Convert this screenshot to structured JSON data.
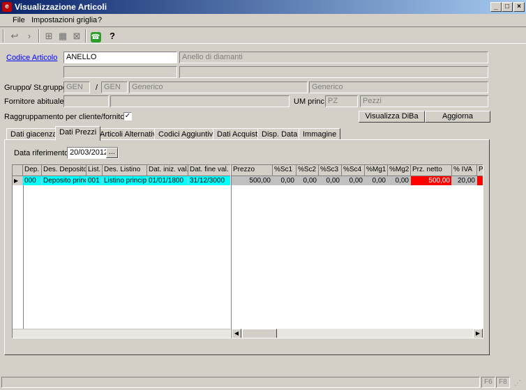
{
  "window": {
    "title": "Visualizzazione Articoli",
    "app_icon": "e"
  },
  "menu": [
    "File",
    "Impostazioni griglia",
    "?"
  ],
  "toolbar_icons": [
    "undo-icon",
    "redo-icon",
    "filter-icon",
    "grid-icon",
    "filter-clear-icon",
    "phone-icon",
    "help-icon"
  ],
  "form": {
    "codice_label": "Codice Articolo",
    "codice_value": "ANELLO",
    "descrizione": "Anello di diamanti",
    "gruppo_label": "Gruppo",
    "stgruppo_label": "/ St.gruppo",
    "gruppo_code": "GEN",
    "slash": "/",
    "stgruppo_code": "GEN",
    "gruppo_desc": "Generico",
    "stgruppo_desc": "Generico",
    "fornitore_label": "Fornitore abituale",
    "um_label": "UM princ.",
    "um_code": "PZ",
    "um_desc": "Pezzi",
    "raggruppamento_label": "Raggruppamento per cliente/fornitore",
    "raggruppamento_checked": "✓",
    "btn_diba": "Visualizza DiBa",
    "btn_aggiorna": "Aggiorna"
  },
  "tabs": [
    "Dati giacenza",
    "Dati Prezzi",
    "Articoli Alternativi",
    "Codici Aggiuntivi",
    "Dati Acquisti",
    "Disp. Data",
    "Immagine"
  ],
  "active_tab": "Dati Prezzi",
  "prezzi": {
    "data_rif_label": "Data riferimento",
    "data_rif_value": "20/03/2012",
    "data_btn": "...",
    "left_columns": [
      "Dep.",
      "Des. Deposito",
      "List.",
      "Des. Listino",
      "Dat. iniz. val.",
      "Dat. fine val."
    ],
    "right_columns": [
      "Prezzo",
      "%Sc1",
      "%Sc2",
      "%Sc3",
      "%Sc4",
      "%Mg1",
      "%Mg2",
      "Prz. netto",
      "% IVA",
      "P"
    ],
    "row_left": [
      "000",
      "Deposito principale",
      "001",
      "Listino principale",
      "01/01/1800",
      "31/12/3000"
    ],
    "row_right": [
      "500,00",
      "0,00",
      "0,00",
      "0,00",
      "0,00",
      "0,00",
      "0,00",
      "500,00",
      "20,00",
      ""
    ]
  },
  "status": {
    "f6": "F6",
    "f8": "F8"
  }
}
